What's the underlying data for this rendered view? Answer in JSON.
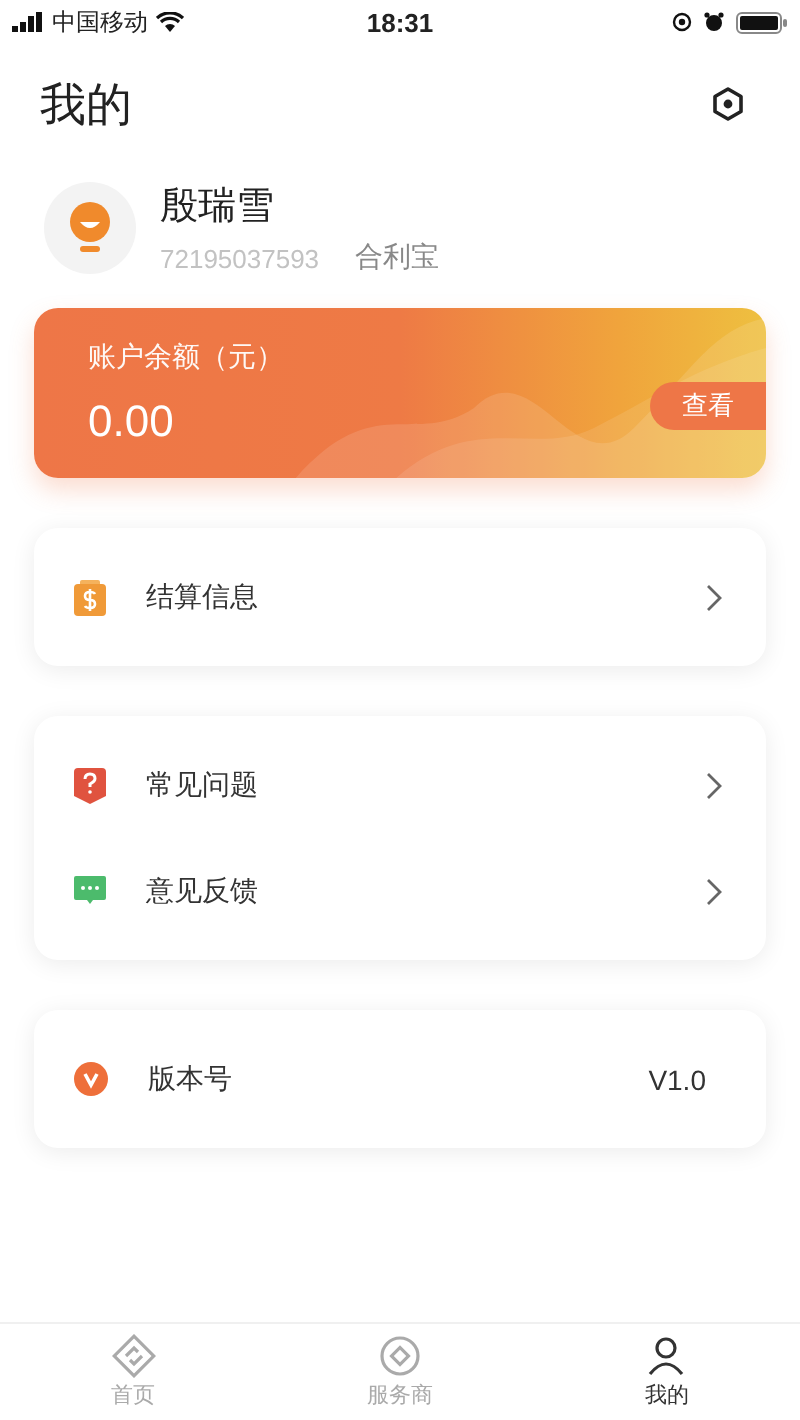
{
  "status_bar": {
    "carrier": "中国移动",
    "time": "18:31"
  },
  "header": {
    "title": "我的"
  },
  "profile": {
    "name": "殷瑞雪",
    "phone": "72195037593",
    "company": "合利宝"
  },
  "balance_card": {
    "label": "账户余额（元）",
    "amount": "0.00",
    "button": "查看"
  },
  "menu_groups": [
    {
      "items": [
        {
          "kind": "settlement",
          "label": "结算信息",
          "arrow": true
        }
      ]
    },
    {
      "items": [
        {
          "kind": "faq",
          "label": "常见问题",
          "arrow": true
        },
        {
          "kind": "feedback",
          "label": "意见反馈",
          "arrow": true
        }
      ]
    },
    {
      "items": [
        {
          "kind": "version",
          "label": "版本号",
          "value": "V1.0",
          "arrow": false
        }
      ]
    }
  ],
  "tab_bar": [
    {
      "kind": "home",
      "label": "首页",
      "selected": false
    },
    {
      "kind": "provider",
      "label": "服务商",
      "selected": false
    },
    {
      "kind": "mine",
      "label": "我的",
      "selected": true
    }
  ]
}
